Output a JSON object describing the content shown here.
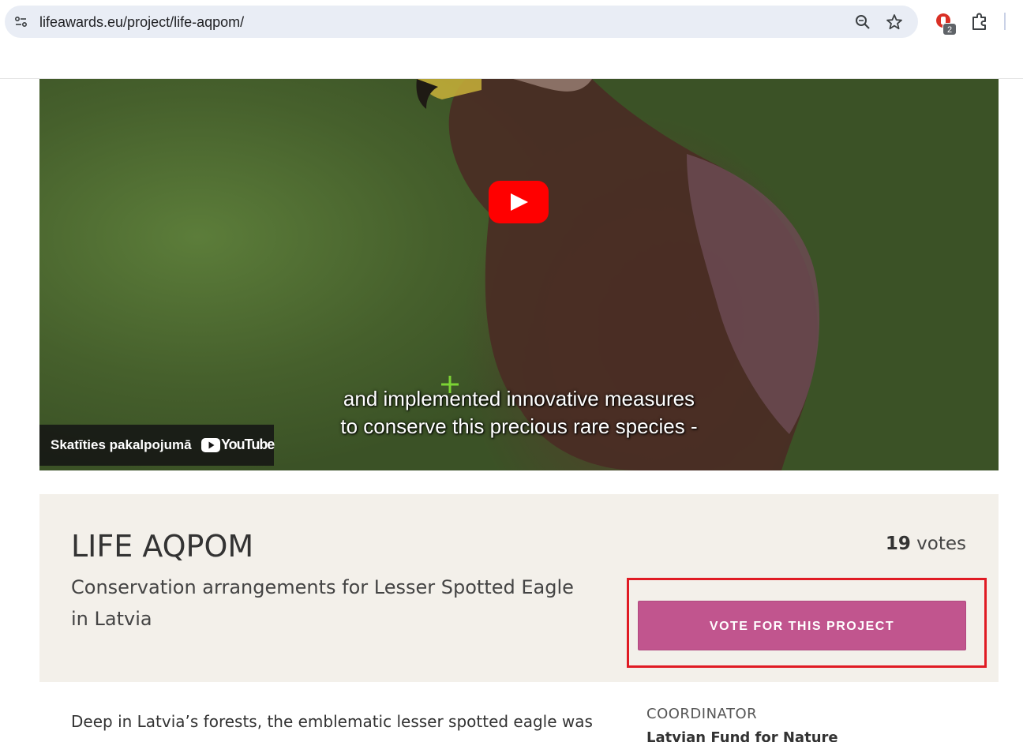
{
  "browser": {
    "url": "lifeawards.eu/project/life-aqpom/",
    "extension_badge": "2",
    "icons": [
      "site-info-icon",
      "zoom-icon",
      "star-icon",
      "extension-icon",
      "puzzle-icon"
    ]
  },
  "video": {
    "subtitle_line1": "and implemented innovative measures",
    "subtitle_line2": "to conserve this precious rare species -",
    "watch_on_label": "Skatīties pakalpojumā",
    "youtube_label": "YouTube"
  },
  "project": {
    "title": "LIFE AQPOM",
    "subtitle": "Conservation arrangements for Lesser Spotted Eagle in Latvia",
    "votes_count": "19",
    "votes_label": "votes",
    "vote_button_label": "VOTE FOR THIS PROJECT",
    "accent_color": "#c1558e",
    "highlight_color": "#e01b24"
  },
  "content": {
    "description_start": "Deep in Latvia’s forests, the emblematic lesser spotted eagle was",
    "coordinator_label": "COORDINATOR",
    "coordinator_name": "Latvian Fund for Nature"
  }
}
